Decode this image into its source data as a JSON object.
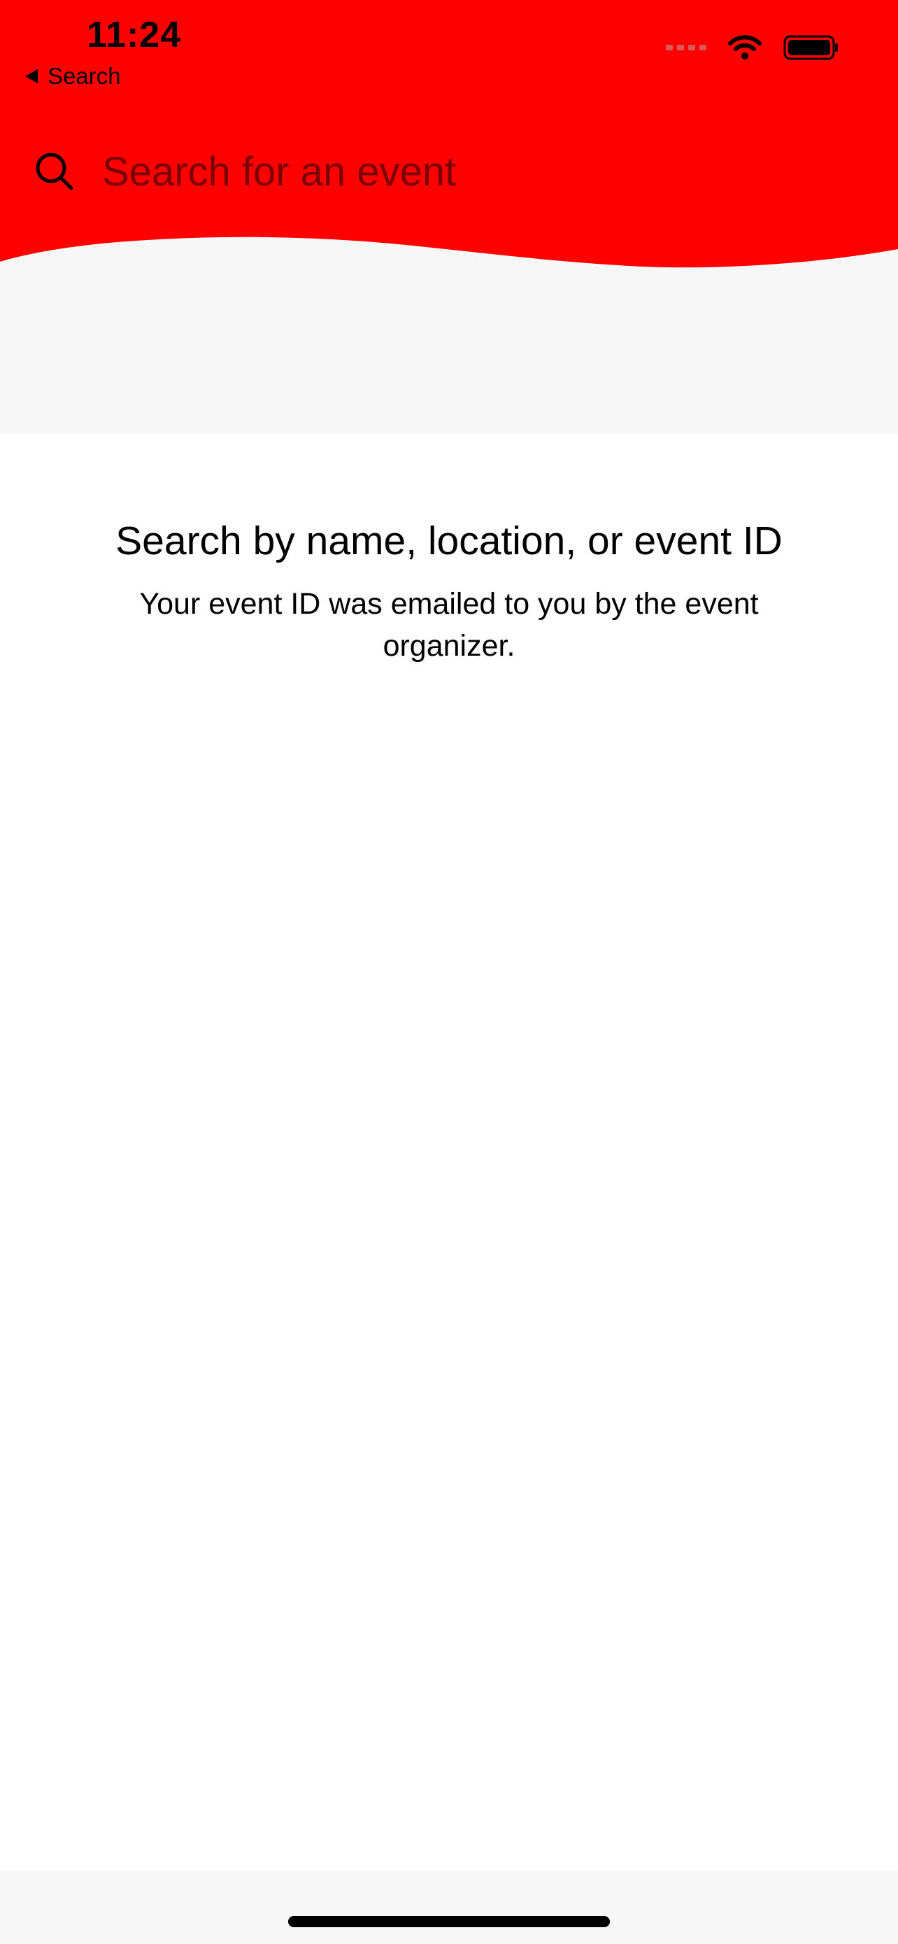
{
  "colors": {
    "brand": "#ff0000",
    "background": "#ffffff",
    "band": "#f7f7f7",
    "text": "#000000"
  },
  "status_bar": {
    "time": "11:24",
    "back_label": "Search"
  },
  "search": {
    "placeholder": "Search for an event",
    "value": "",
    "icon": "search-icon"
  },
  "empty_state": {
    "title": "Search by name, location, or event ID",
    "subtitle": "Your event ID was emailed to you by the event organizer."
  }
}
